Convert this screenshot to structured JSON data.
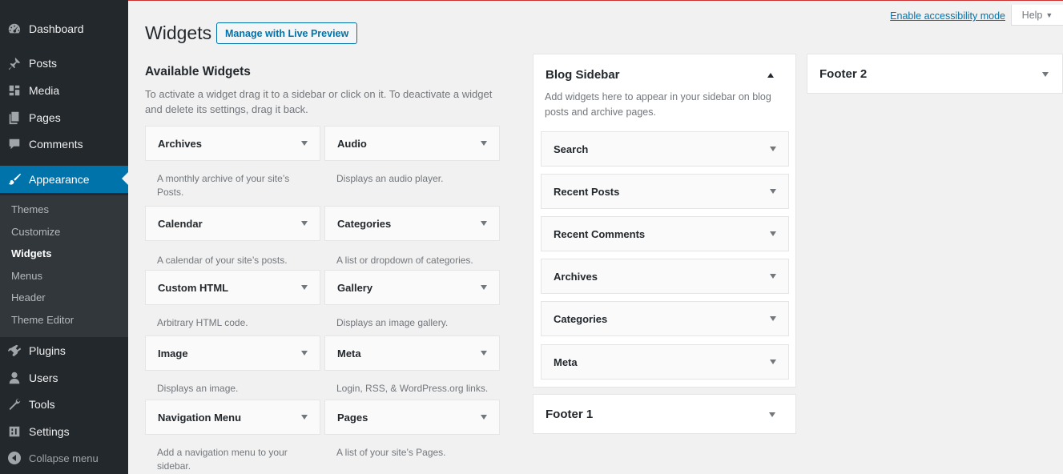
{
  "menu": {
    "items": [
      {
        "label": "Dashboard",
        "icon": "dashboard-icon"
      },
      {
        "label": "Posts",
        "icon": "pin-icon"
      },
      {
        "label": "Media",
        "icon": "media-icon"
      },
      {
        "label": "Pages",
        "icon": "pages-icon"
      },
      {
        "label": "Comments",
        "icon": "comments-icon"
      },
      {
        "label": "Appearance",
        "icon": "brush-icon"
      },
      {
        "label": "Plugins",
        "icon": "plugins-icon"
      },
      {
        "label": "Users",
        "icon": "users-icon"
      },
      {
        "label": "Tools",
        "icon": "tools-icon"
      },
      {
        "label": "Settings",
        "icon": "settings-icon"
      }
    ],
    "submenu": [
      "Themes",
      "Customize",
      "Widgets",
      "Menus",
      "Header",
      "Theme Editor"
    ],
    "collapse_label": "Collapse menu"
  },
  "screen_meta": {
    "accessibility_link": "Enable accessibility mode",
    "help_label": "Help"
  },
  "header": {
    "title": "Widgets",
    "live_preview_button": "Manage with Live Preview"
  },
  "available": {
    "heading": "Available Widgets",
    "description": "To activate a widget drag it to a sidebar or click on it. To deactivate a widget and delete its settings, drag it back.",
    "widgets": [
      {
        "title": "Archives",
        "desc": "A monthly archive of your site’s Posts."
      },
      {
        "title": "Audio",
        "desc": "Displays an audio player."
      },
      {
        "title": "Calendar",
        "desc": "A calendar of your site’s posts."
      },
      {
        "title": "Categories",
        "desc": "A list or dropdown of categories."
      },
      {
        "title": "Custom HTML",
        "desc": "Arbitrary HTML code."
      },
      {
        "title": "Gallery",
        "desc": "Displays an image gallery."
      },
      {
        "title": "Image",
        "desc": "Displays an image."
      },
      {
        "title": "Meta",
        "desc": "Login, RSS, & WordPress.org links."
      },
      {
        "title": "Navigation Menu",
        "desc": "Add a navigation menu to your sidebar."
      },
      {
        "title": "Pages",
        "desc": "A list of your site’s Pages."
      }
    ]
  },
  "blog_sidebar": {
    "title": "Blog Sidebar",
    "description": "Add widgets here to appear in your sidebar on blog posts and archive pages.",
    "widgets": [
      "Search",
      "Recent Posts",
      "Recent Comments",
      "Archives",
      "Categories",
      "Meta"
    ]
  },
  "footer1": {
    "title": "Footer 1"
  },
  "footer2": {
    "title": "Footer 2"
  },
  "colors": {
    "accent": "#0073aa",
    "menu_bg": "#23282d",
    "submenu_bg": "#32373c"
  }
}
